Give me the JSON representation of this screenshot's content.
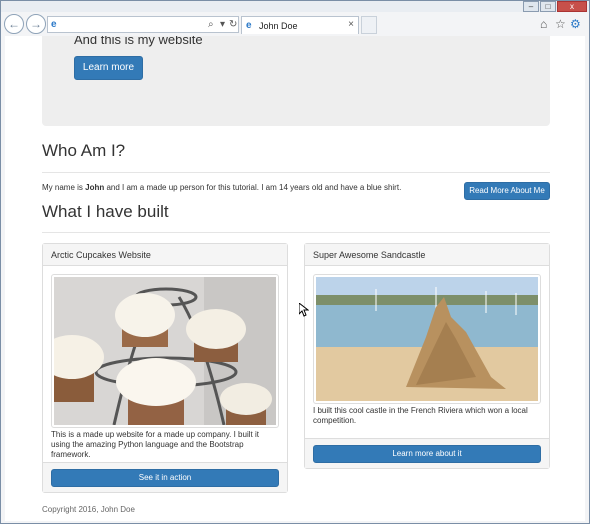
{
  "browser": {
    "tab_title": "John Doe",
    "tab_close": "×",
    "address_value": "",
    "search_glyph": "⌕",
    "dropdown_glyph": "▾",
    "refresh_glyph": "↻",
    "back_glyph": "←",
    "forward_glyph": "→",
    "home_glyph": "⌂",
    "favorites_glyph": "☆",
    "settings_glyph": "⚙",
    "window_controls": {
      "minimize": "–",
      "maximize": "□",
      "close": "x"
    }
  },
  "jumbotron": {
    "subtitle": "And this is my website",
    "button_label": "Learn more"
  },
  "about": {
    "heading": "Who Am I?",
    "text_before": "My name is ",
    "name": "John",
    "text_after": " and I am a made up person for this tutorial. I am 14 years old and have a blue shirt.",
    "button_label": "Read More About Me"
  },
  "built": {
    "heading": "What I have built",
    "projects": [
      {
        "title": "Arctic Cupcakes Website",
        "description": "This is a made up website for a made up company. I built it using the amazing Python language and the Bootstrap framework.",
        "button_label": "See it in action"
      },
      {
        "title": "Super Awesome Sandcastle",
        "description": "I built this cool castle in the French Riviera which won a local competition.",
        "button_label": "Learn more about it"
      }
    ]
  },
  "footer": {
    "text": "Copyright 2016, John Doe"
  },
  "colors": {
    "primary": "#337ab7",
    "jumbotron_bg": "#eeeeee",
    "panel_heading_bg": "#f5f5f5"
  }
}
